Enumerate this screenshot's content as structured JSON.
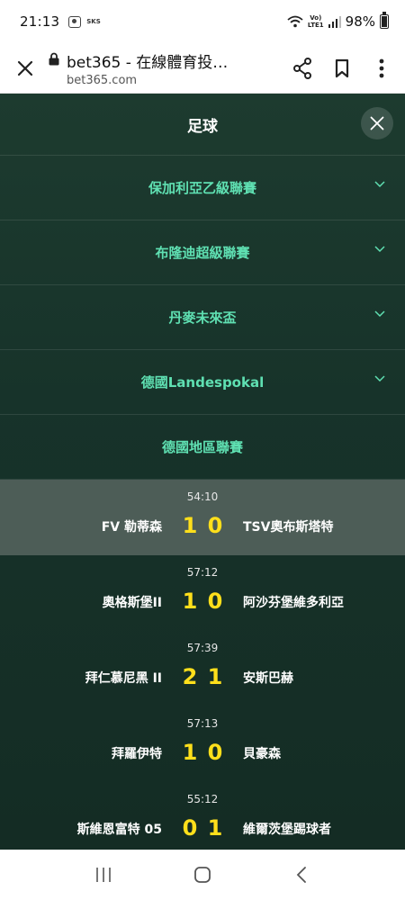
{
  "status_bar": {
    "time": "21:13",
    "sks_label": "SKS",
    "volte_top": "Vo)",
    "volte_bottom": "LTE1",
    "battery": "98%"
  },
  "browser": {
    "page_title": "bet365 - 在線體育投…",
    "url": "bet365.com",
    "icons": [
      "close-icon",
      "lock-icon",
      "share-icon",
      "bookmark-icon",
      "more-icon"
    ]
  },
  "panel": {
    "title": "足球",
    "leagues": [
      {
        "name": "保加利亞乙級聯賽",
        "expandable": true
      },
      {
        "name": "布隆迪超級聯賽",
        "expandable": true
      },
      {
        "name": "丹麥未來盃",
        "expandable": true
      },
      {
        "name": "德國Landespokal",
        "expandable": true
      },
      {
        "name": "德國地區聯賽",
        "expandable": false
      }
    ],
    "matches": [
      {
        "time": "54:10",
        "home": "FV 勒蒂森",
        "home_score": "1",
        "away_score": "0",
        "away": "TSV奧布斯塔特",
        "highlighted": true
      },
      {
        "time": "57:12",
        "home": "奧格斯堡II",
        "home_score": "1",
        "away_score": "0",
        "away": "阿沙芬堡維多利亞",
        "highlighted": false
      },
      {
        "time": "57:39",
        "home": "拜仁慕尼黑 II",
        "home_score": "2",
        "away_score": "1",
        "away": "安斯巴赫",
        "highlighted": false
      },
      {
        "time": "57:13",
        "home": "拜羅伊特",
        "home_score": "1",
        "away_score": "0",
        "away": "貝豪森",
        "highlighted": false
      },
      {
        "time": "55:12",
        "home": "斯維恩富特 05",
        "home_score": "0",
        "away_score": "1",
        "away": "維爾茨堡踢球者",
        "highlighted": false
      }
    ]
  },
  "colors": {
    "panel_bg": "#17332a",
    "league_text": "#5fe0b2",
    "score": "#ffdf1b",
    "highlight_row": "#4d5d57"
  },
  "nav_bar": {
    "icons": [
      "recent-apps-icon",
      "home-icon",
      "back-icon"
    ]
  }
}
